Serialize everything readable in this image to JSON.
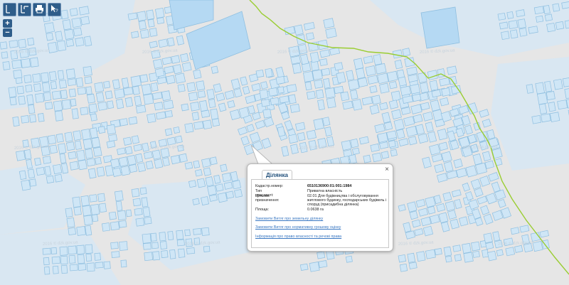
{
  "map": {
    "colors": {
      "ground": "#e6e6e6",
      "parcel_fill": "#cfe6f6",
      "parcel_stroke": "#8fbfe0",
      "large_block": "#b5d9f3",
      "boundary": "#9acd32",
      "watermark": "#c7d3dd"
    },
    "watermark_text": "2016 © dzk.gov.ua"
  },
  "toolbar": {
    "buttons": [
      {
        "name": "measure-length-button",
        "icon": "ruler-icon",
        "label": "м"
      },
      {
        "name": "measure-area-button",
        "icon": "area-ruler-icon",
        "label": "м²"
      },
      {
        "name": "print-button",
        "icon": "printer-icon",
        "label": ""
      },
      {
        "name": "identify-button",
        "icon": "cursor-question-icon",
        "label": "?"
      }
    ],
    "zoom_in": "+",
    "zoom_out": "−"
  },
  "popup": {
    "tab_title": "Ділянка",
    "close_symbol": "×",
    "fields": [
      {
        "label": "Кадастр.номер:",
        "value": "6510136900:01:001:1984"
      },
      {
        "label": "Тип власності:",
        "value": "Приватна власність"
      },
      {
        "label": "Цільове призначення:",
        "value": "02.01 Для будівництва і обслуговування житлового будинку, господарських будівель і споруд (присадибна ділянка)"
      },
      {
        "label": "Площа:",
        "value": "0.0638 га"
      }
    ],
    "links": [
      "Замовити Витяг про земельну ділянку",
      "Замовити Витяг про нормативну грошову оцінку",
      "Інформація про право власності та речові права"
    ]
  }
}
